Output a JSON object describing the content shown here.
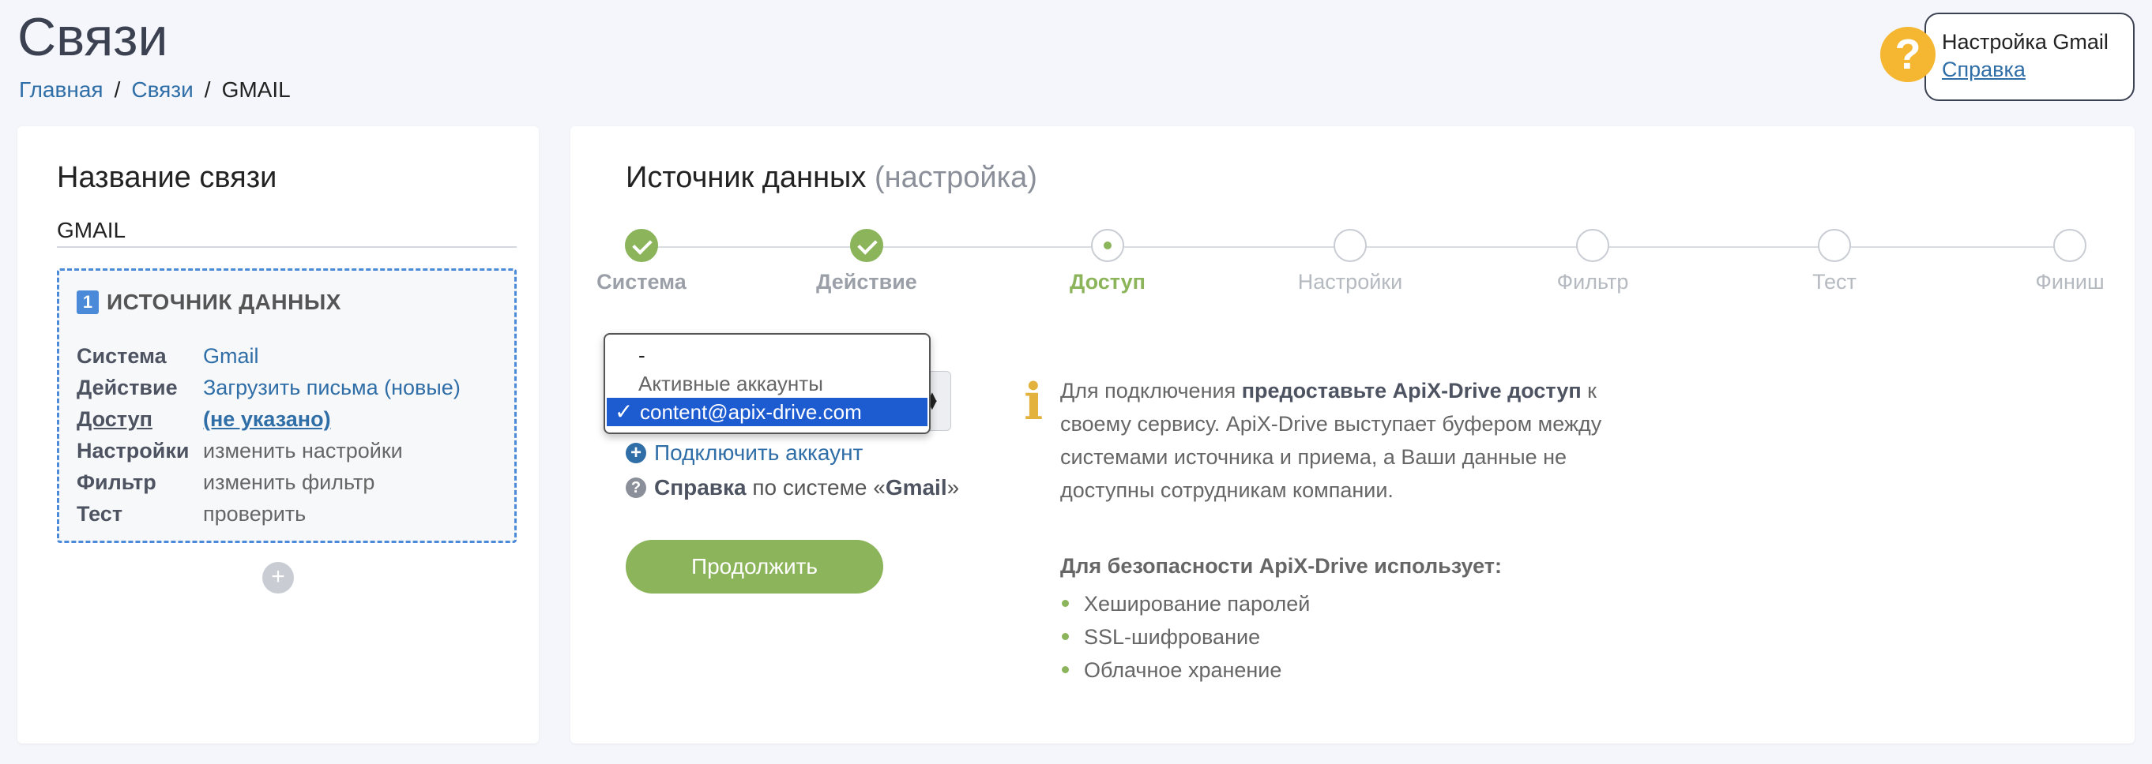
{
  "page": {
    "title": "Связи"
  },
  "breadcrumb": [
    "Главная",
    "/",
    "Связи",
    "/",
    "GMAIL"
  ],
  "help": {
    "badge": "?",
    "title": "Настройка Gmail",
    "link": "Справка"
  },
  "left": {
    "title": "Название связи",
    "name_value": "GMAIL",
    "source": {
      "number": "1",
      "title": "ИСТОЧНИК ДАННЫХ",
      "rows": [
        {
          "key": "Система",
          "value": "Gmail"
        },
        {
          "key": "Действие",
          "value": "Загрузить письма (новые)"
        },
        {
          "key": "Доступ",
          "value": "(не указано)"
        },
        {
          "key": "Настройки",
          "value": "изменить настройки"
        },
        {
          "key": "Фильтр",
          "value": "изменить фильтр"
        },
        {
          "key": "Тест",
          "value": "проверить"
        }
      ]
    },
    "add_button": "+"
  },
  "right": {
    "title": "Источник данных",
    "title_suffix": "(настройка)",
    "steps": [
      {
        "label": "Система",
        "state": "done"
      },
      {
        "label": "Действие",
        "state": "done"
      },
      {
        "label": "Доступ",
        "state": "active"
      },
      {
        "label": "Настройки",
        "state": "pending"
      },
      {
        "label": "Фильтр",
        "state": "pending"
      },
      {
        "label": "Тест",
        "state": "pending"
      },
      {
        "label": "Финиш",
        "state": "pending"
      }
    ],
    "dropdown": {
      "options": [
        {
          "label": "-",
          "type": "option"
        },
        {
          "label": "Активные аккаунты",
          "type": "group"
        },
        {
          "label": "content@apix-drive.com",
          "type": "selected"
        }
      ],
      "check": "✓"
    },
    "connect_link": "Подключить аккаунт",
    "help_system": {
      "prefix": "Справка",
      "middle": " по системе «",
      "system": "Gmail",
      "suffix": "»"
    },
    "continue_button": "Продолжить",
    "info": {
      "p1": "Для подключения ",
      "b1": "предоставьте ApiX-Drive доступ",
      "p2": " к своему сервису. ApiX-Drive выступает буфером между системами источника и приема, а Ваши данные не доступны сотрудникам компании."
    },
    "security": {
      "title": "Для безопасности ApiX-Drive использует:",
      "items": [
        "Хеширование паролей",
        "SSL-шифрование",
        "Облачное хранение"
      ]
    },
    "colors": {
      "accent_green": "#8bb45b",
      "link_blue": "#2f6ea7",
      "help_yellow": "#f5b731"
    }
  }
}
